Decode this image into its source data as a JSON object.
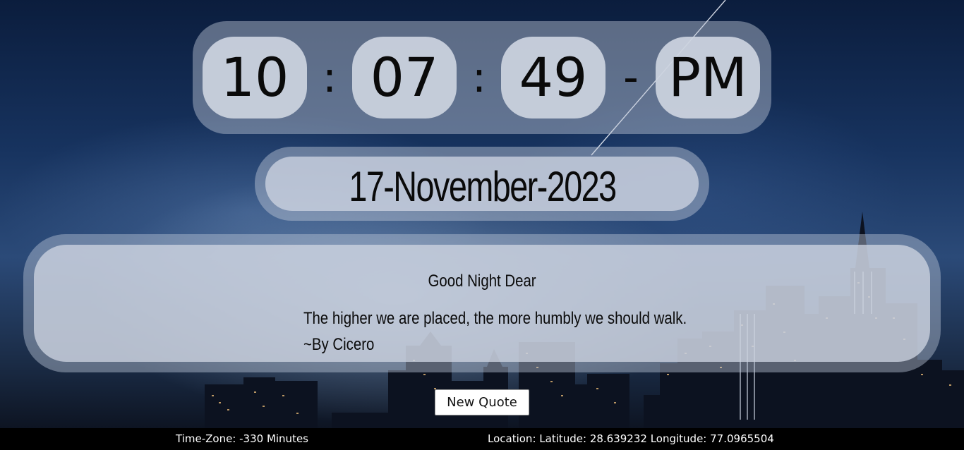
{
  "clock": {
    "hours": "10",
    "separator1": ":",
    "minutes": "07",
    "separator2": ":",
    "seconds": "49",
    "separator3": "-",
    "meridiem": "PM"
  },
  "date": "17-November-2023",
  "quote": {
    "greeting": "Good Night Dear",
    "text": "The higher we are placed, the more humbly we should walk.",
    "author": "~By Cicero"
  },
  "new_quote_button": "New Quote",
  "footer": {
    "timezone": "Time-Zone: -330 Minutes",
    "location": "Location: Latitude: 28.639232 Longitude: 77.0965504"
  }
}
